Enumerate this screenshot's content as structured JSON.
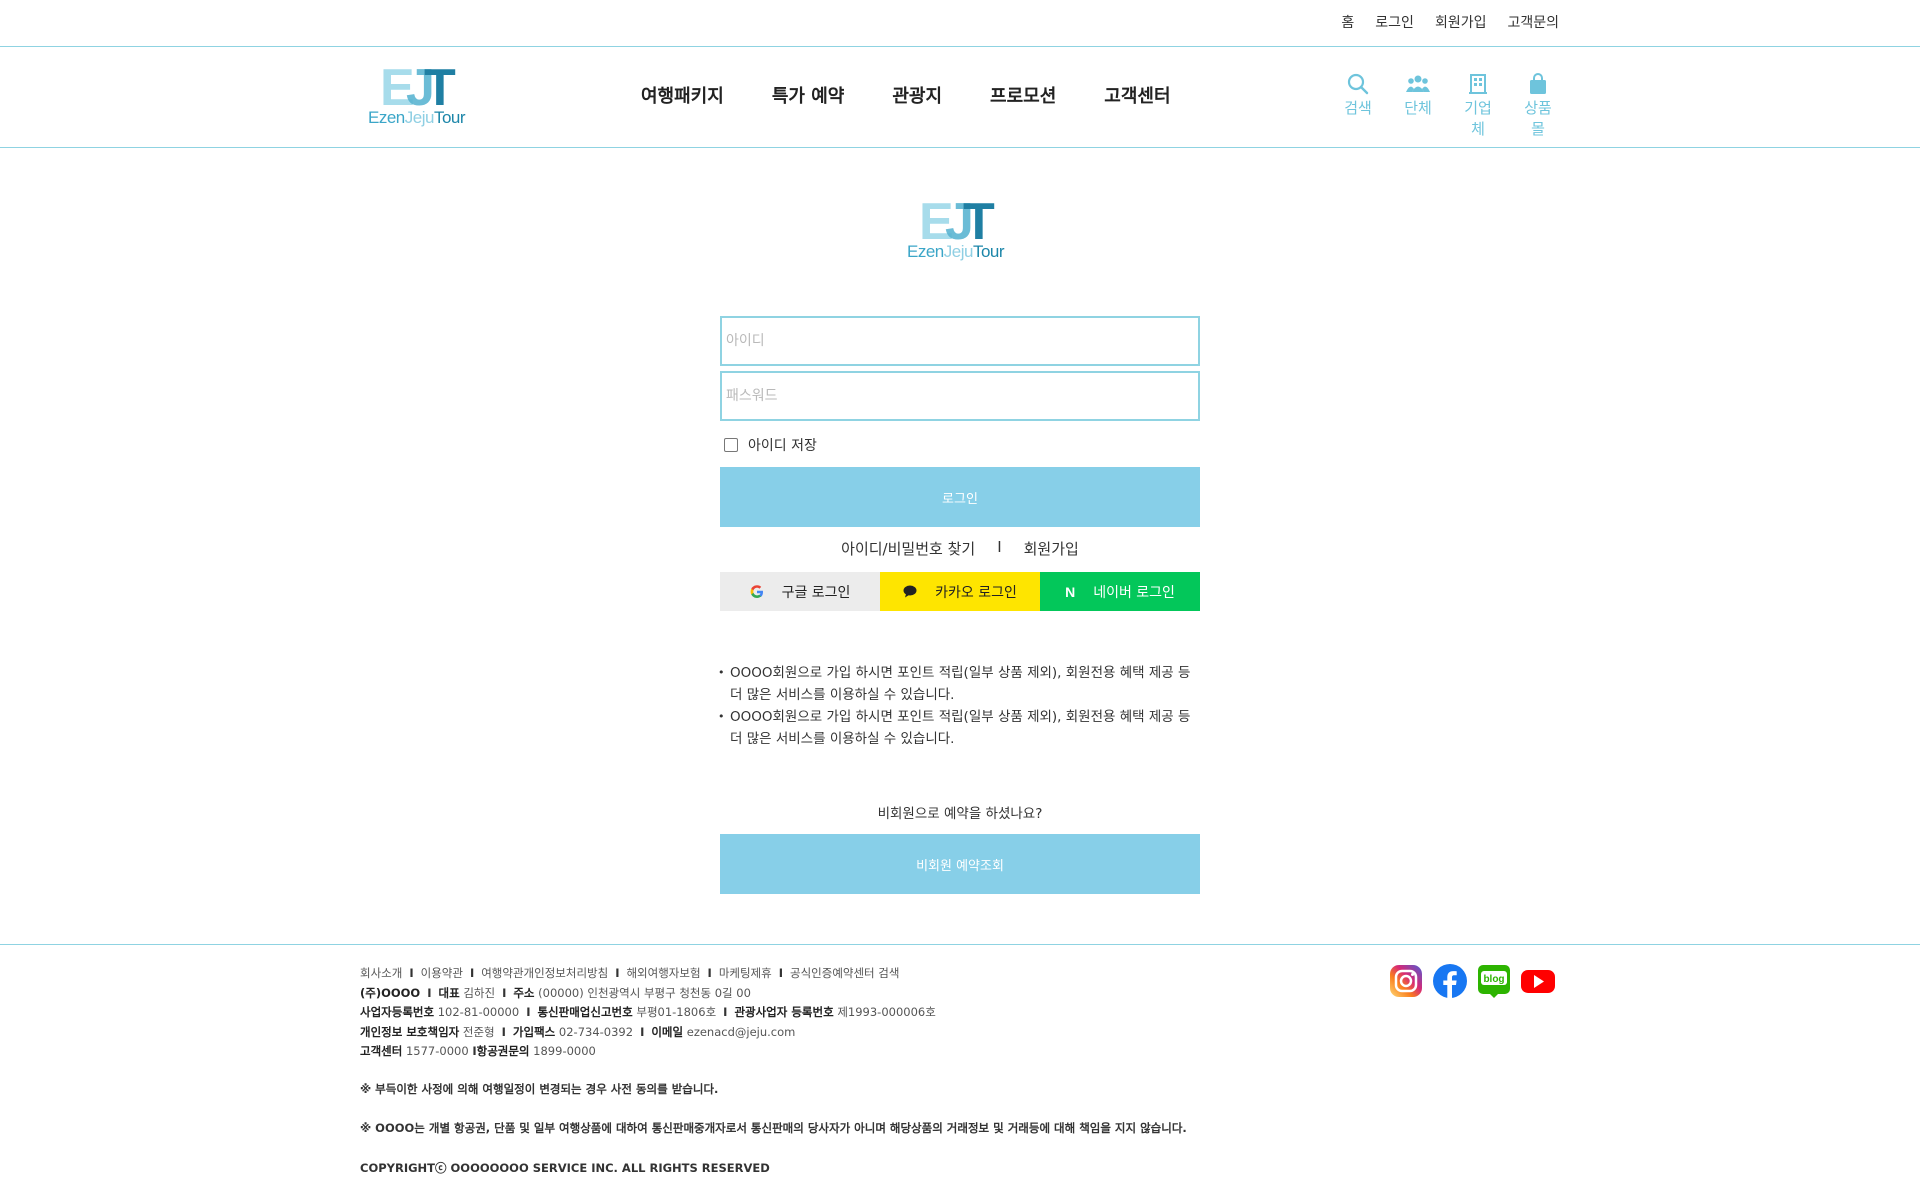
{
  "colors": {
    "accent": "#87cfe8",
    "line": "#8fd3e2",
    "kakao": "#fee500",
    "naver": "#03c75a"
  },
  "util_nav": [
    "홈",
    "로그인",
    "회원가입",
    "고객문의"
  ],
  "logo": {
    "letters": "EJT",
    "word_a": "Ezen",
    "word_b": "Jeju",
    "word_c": "Tour"
  },
  "main_nav": [
    "여행패키지",
    "특가 예약",
    "관광지",
    "프로모션",
    "고객센터"
  ],
  "header_icons": [
    {
      "icon": "search-icon",
      "label": "검색"
    },
    {
      "icon": "group-icon",
      "label": "단체"
    },
    {
      "icon": "building-icon",
      "label": "기업체"
    },
    {
      "icon": "shopping-bag-icon",
      "label": "상품몰"
    }
  ],
  "login": {
    "id_placeholder": "아이디",
    "pw_placeholder": "패스워드",
    "save_id_label": "아이디 저장",
    "login_button": "로그인",
    "find_link": "아이디/비밀번호 찾기",
    "link_sep": "I",
    "signup_link": "회원가입",
    "google": "구글 로그인",
    "kakao": "카카오 로그인",
    "naver": "네이버 로그인",
    "naver_glyph": "N"
  },
  "notes": [
    "OOOO회원으로 가입 하시면 포인트 적립(일부 상품 제외), 회원전용 혜택 제공 등 더 많은 서비스를 이용하실 수 있습니다.",
    "OOOO회원으로 가입 하시면 포인트 적립(일부 상품 제외), 회원전용 혜택 제공 등 더 많은 서비스를 이용하실 수 있습니다."
  ],
  "guest": {
    "question": "비회원으로 예약을 하셨나요?",
    "button": "비회원 예약조회"
  },
  "footer": {
    "links": [
      "회사소개",
      "이용약관",
      "여행약관개인정보처리방침",
      "해외여행자보험",
      "마케팅제휴",
      "공식인증예약센터 검색"
    ],
    "company": "(주)OOOO",
    "ceo_label": "대표",
    "ceo": "김하진",
    "addr_label": "주소",
    "addr": "(00000) 인천광역시 부평구 청천동 0길 00",
    "biz_label": "사업자등록번호",
    "biz": "102-81-00000",
    "mail_order_label": "통신판매업신고번호",
    "mail_order": "부평01-1806호",
    "tour_label": "관광사업자 등록번호",
    "tour": "제1993-000006호",
    "privacy_label": "개인정보 보호책임자",
    "privacy": "전준형",
    "fax_label": "가입팩스",
    "fax": "02-734-0392",
    "email_label": "이메일",
    "email": "ezenacd@jeju.com",
    "cs_label": "고객센터",
    "cs": "1577-0000",
    "air_label": "항공권문의",
    "air": "1899-0000",
    "notice1": "※ 부득이한 사정에 의해 여행일정이 변경되는 경우 사전 동의를 받습니다.",
    "notice2": "※ OOOO는 개별 항공권, 단품 및 일부 여행상품에 대하여 통신판매중개자로서 통신판매의 당사자가 아니며 해당상품의 거래정보 및 거래등에 대해 책임을 지지 않습니다.",
    "copyright": "COPYRIGHTⓒ OOOOOOOO SERVICE INC. ALL RIGHTS RESERVED"
  },
  "sns": [
    {
      "icon": "instagram-icon",
      "color": "#e1306c"
    },
    {
      "icon": "facebook-icon",
      "color": "#1877f2"
    },
    {
      "icon": "blog-icon",
      "color": "#2db400",
      "text": "blog"
    },
    {
      "icon": "youtube-icon",
      "color": "#ff0000"
    }
  ]
}
